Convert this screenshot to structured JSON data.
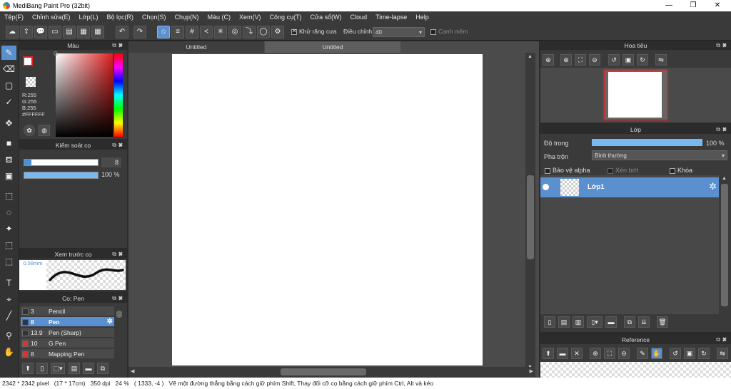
{
  "window": {
    "title": "MediBang Paint Pro (32bit)",
    "minimize": "—",
    "maximize": "❐",
    "close": "✕"
  },
  "menu": [
    "Tệp(F)",
    "Chỉnh sửa(E)",
    "Lớp(L)",
    "Bộ lọc(R)",
    "Chọn(S)",
    "Chụp(N)",
    "Màu (C)",
    "Xem(V)",
    "Công cụ(T)",
    "Cửa sổ(W)",
    "Cloud",
    "Time-lapse",
    "Help"
  ],
  "toolbar": {
    "antialias_label": "Khử răng cưa",
    "adjust_label": "Điều chỉnh",
    "adjust_value": "40",
    "smooth_label": "Cạnh mềm"
  },
  "color_panel": {
    "title": "Màu",
    "r": "R:255",
    "g": "G:255",
    "b": "B:255",
    "hex": "#FFFFFF",
    "fg_color": "#ffffff",
    "bg_color": "#ffffff",
    "accent": "#e02020"
  },
  "brush_control": {
    "title": "Kiểm soát cọ",
    "size": "8",
    "size_fraction": 0.1,
    "opacity": "100 %",
    "opacity_fraction": 1.0
  },
  "brush_preview": {
    "title": "Xem trước cọ",
    "size_label": "0.58mm"
  },
  "brush_list": {
    "title": "Cọ: Pen",
    "items": [
      {
        "size": "3",
        "name": "Pencil",
        "color": "#333333",
        "selected": false
      },
      {
        "size": "8",
        "name": "Pen",
        "color": "#1f3a5f",
        "selected": true
      },
      {
        "size": "13.9",
        "name": "Pen (Sharp)",
        "color": "#333333",
        "selected": false
      },
      {
        "size": "10",
        "name": "G Pen",
        "color": "#e03030",
        "selected": false
      },
      {
        "size": "8",
        "name": "Mapping Pen",
        "color": "#e03030",
        "selected": false
      }
    ]
  },
  "canvas": {
    "tabs": [
      "Untitled",
      "Untitled"
    ]
  },
  "navigator": {
    "title": "Hoa tiêu"
  },
  "layer_panel": {
    "title": "Lớp",
    "opacity_label": "Độ trong",
    "opacity_value": "100 %",
    "opacity_fraction": 1.0,
    "blend_label": "Pha trộn",
    "blend_value": "Bình thường",
    "protect_alpha": "Bảo vệ alpha",
    "clipping": "Xén bớt",
    "lock": "Khóa",
    "layers": [
      {
        "name": "Lớp1"
      }
    ]
  },
  "reference": {
    "title": "Reference"
  },
  "status": {
    "size": "2342 * 2342 pixel",
    "physical": "(17 * 17cm)",
    "dpi": "350 dpi",
    "zoom": "24 %",
    "coords": "( 1333, -4 )",
    "hint": "Vẽ một đường thẳng bằng cách giữ phím Shift, Thay đổi cỡ cọ bằng cách giữ phím Ctrl, Alt và kéo"
  }
}
